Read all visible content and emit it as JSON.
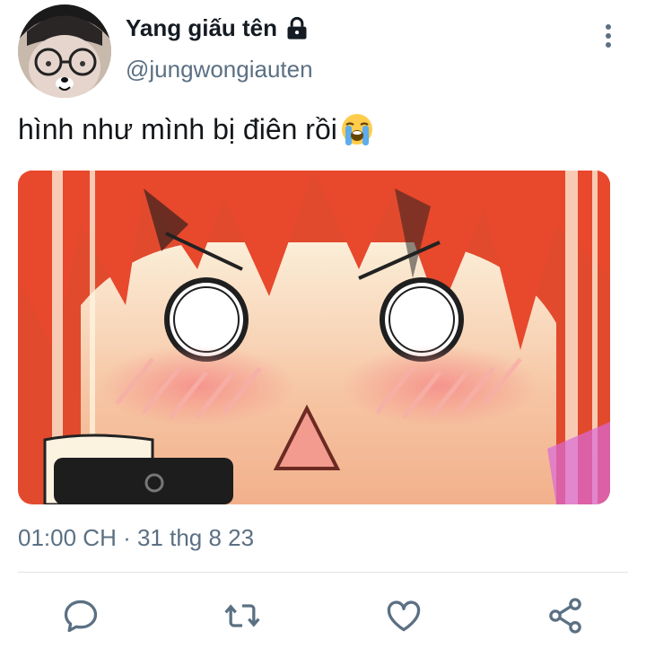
{
  "tweet": {
    "display_name": "Yang giấu tên",
    "handle": "@jungwongiauten",
    "text": "hình như mình bị điên rồi",
    "timestamp": "01:00 CH · 31 thg 8 23"
  },
  "icons": {
    "lock": "lock-icon",
    "more": "more-vertical-icon",
    "emoji": "loudly-crying-face-emoji",
    "reply": "reply-icon",
    "retweet": "retweet-icon",
    "like": "heart-icon",
    "share": "share-icon"
  },
  "colors": {
    "text_primary": "#0f1419",
    "text_secondary": "#5b7083",
    "divider": "#dfe3e6",
    "icon_gray": "#5b7083"
  }
}
